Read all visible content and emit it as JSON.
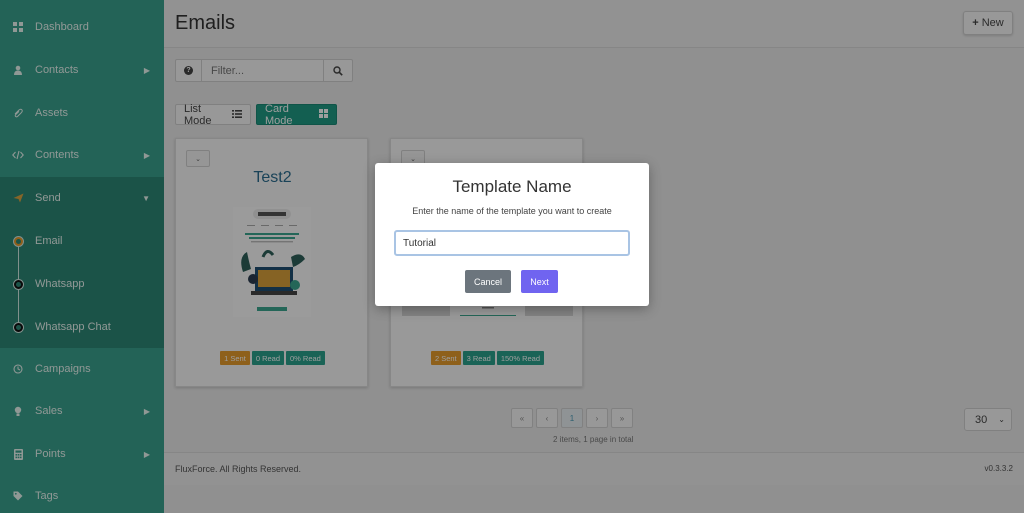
{
  "sidebar": {
    "items": [
      {
        "label": "Dashboard",
        "icon": "grid-icon"
      },
      {
        "label": "Contacts",
        "icon": "user-icon"
      },
      {
        "label": "Assets",
        "icon": "paperclip-icon"
      },
      {
        "label": "Contents",
        "icon": "code-icon"
      },
      {
        "label": "Send",
        "icon": "send-icon"
      },
      {
        "label": "Campaigns",
        "icon": "clock-icon"
      },
      {
        "label": "Sales",
        "icon": "lightbulb-icon"
      },
      {
        "label": "Points",
        "icon": "calculator-icon"
      },
      {
        "label": "Tags",
        "icon": "tag-icon"
      }
    ],
    "send_submenu": [
      {
        "label": "Email",
        "active": true
      },
      {
        "label": "Whatsapp",
        "active": false
      },
      {
        "label": "Whatsapp Chat",
        "active": false
      }
    ]
  },
  "header": {
    "title": "Emails",
    "new_label": "New"
  },
  "filter": {
    "placeholder": "Filter...",
    "value": ""
  },
  "modes": {
    "list_label": "List Mode",
    "card_label": "Card Mode"
  },
  "cards": [
    {
      "title": "Test2",
      "badges": [
        "1 Sent",
        "0 Read",
        "0% Read"
      ]
    },
    {
      "title": "",
      "badges": [
        "2 Sent",
        "3 Read",
        "150% Read"
      ]
    }
  ],
  "pagination": {
    "current_page": "1",
    "info": "2 items, 1 page in total",
    "page_size": "30"
  },
  "footer": {
    "copyright": "FluxForce. All Rights Reserved.",
    "version": "v0.3.3.2"
  },
  "modal": {
    "title": "Template Name",
    "description": "Enter the name of the template you want to create",
    "input_value": "Tutorial",
    "cancel_label": "Cancel",
    "next_label": "Next"
  },
  "colors": {
    "sidebar": "#39a08d",
    "submenu": "#2d8675",
    "accent": "#1f9a84",
    "next_button": "#7064f0",
    "cancel_button": "#6c757d",
    "badge_orange": "#e59b2d",
    "badge_teal": "#2aa08b"
  }
}
